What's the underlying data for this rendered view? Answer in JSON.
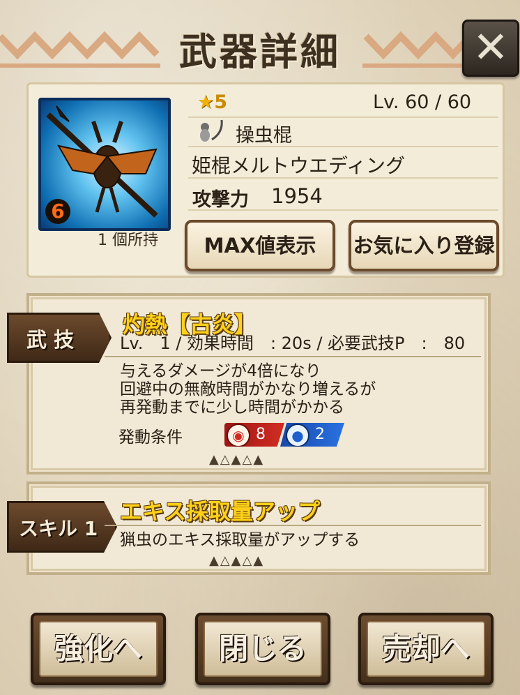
{
  "header": {
    "title": "武器詳細",
    "close_icon": "✕"
  },
  "weapon": {
    "rarity_star": "★",
    "rarity": "5",
    "level": "Lv. 60 / 60",
    "type_icon": "insect-glaive-icon",
    "type": "操虫棍",
    "name": "姫棍メルトウエディング",
    "attack_label": "攻撃力",
    "attack": "1954",
    "owned": "1 個所持",
    "element_badge": "6"
  },
  "buttons": {
    "max_display": "MAX値表示",
    "favorite": "お気に入り登録"
  },
  "bugi": {
    "tab_label": "武 技",
    "title": "灼熱【古炎】",
    "stats": "Lv.　1 / 効果時間　: 20s / 必要武技P　:　80",
    "desc_lines": [
      "与えるダメージが4倍になり",
      "回避中の無敵時間がかなり増えるが",
      "再発動までに少し時間がかかる"
    ],
    "condition_label": "発動条件",
    "conditions": [
      {
        "icon": "fire-icon",
        "value": "8",
        "color": "#c8201e"
      },
      {
        "icon": "water-icon",
        "value": "2",
        "color": "#1e5fcf"
      }
    ]
  },
  "skill": {
    "tab_label": "スキル 1",
    "title": "エキス採取量アップ",
    "desc": "猟虫のエキス採取量がアップする"
  },
  "footer": {
    "enhance": "強化へ",
    "close": "閉じる",
    "sell": "売却へ"
  }
}
